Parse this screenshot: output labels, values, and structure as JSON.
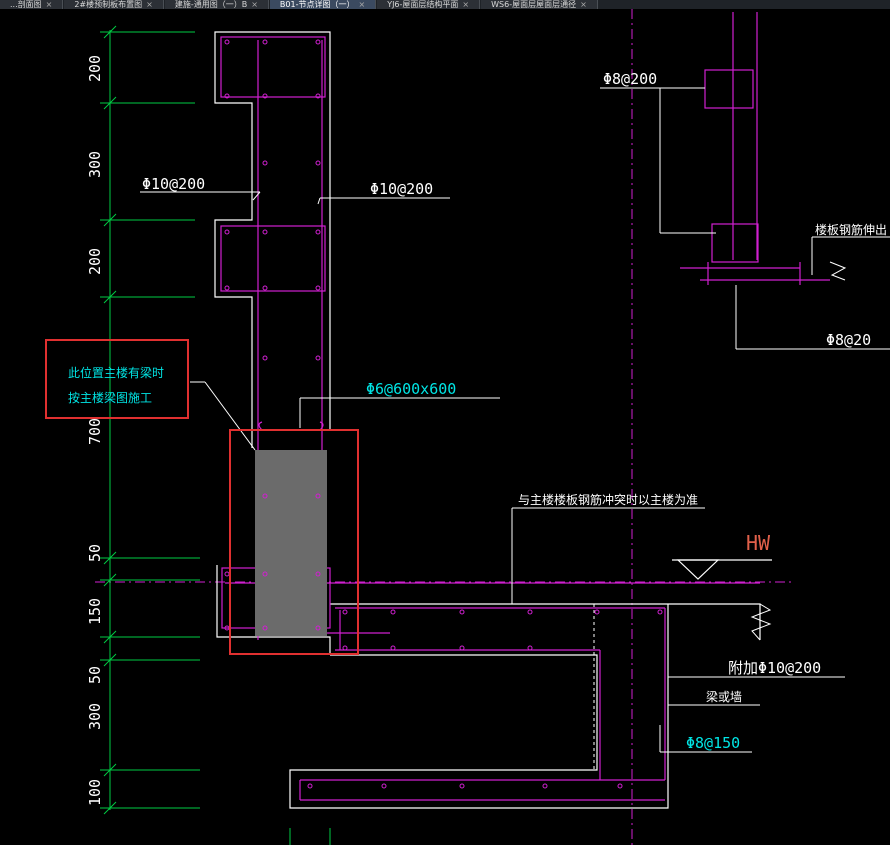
{
  "tabs": [
    {
      "label": "...剖面图",
      "active": false
    },
    {
      "label": "2#楼预制板布置图",
      "active": false
    },
    {
      "label": "建施-通用图（一）B",
      "active": false
    },
    {
      "label": "B01-节点详图（一）",
      "active": true
    },
    {
      "label": "YJ6-屋面层结构平面",
      "active": false
    },
    {
      "label": "WS6-屋面层屋面层通径",
      "active": false
    }
  ],
  "dimensions": {
    "d1": "200",
    "d2": "300",
    "d3": "200",
    "d4": "700",
    "d5": "50",
    "d6": "150",
    "d7": "50",
    "d8": "300",
    "d9": "100"
  },
  "rebar_labels": {
    "left_stirrup": "Φ10@200",
    "right_stirrup": "Φ10@200",
    "tie_bar": "Φ6@600x600",
    "upper_right": "Φ8@200",
    "slab_right": "Φ8@20",
    "added": "附加Φ10@200",
    "wall_stirrup": "Φ8@150"
  },
  "notes": {
    "boxed_line1": "此位置主楼有梁时",
    "boxed_line2": "按主楼梁图施工",
    "conflict": "与主楼楼板钢筋冲突时以主楼为准",
    "slab_extend": "楼板钢筋伸出",
    "beam_or_wall": "梁或墙",
    "hw": "HW"
  },
  "colors": {
    "background": "#000000",
    "outline": "#ffffff",
    "rebar": "#d020d0",
    "dimension": "#00cc44",
    "highlight_box": "#e03030",
    "fill": "#6b6b6b"
  }
}
